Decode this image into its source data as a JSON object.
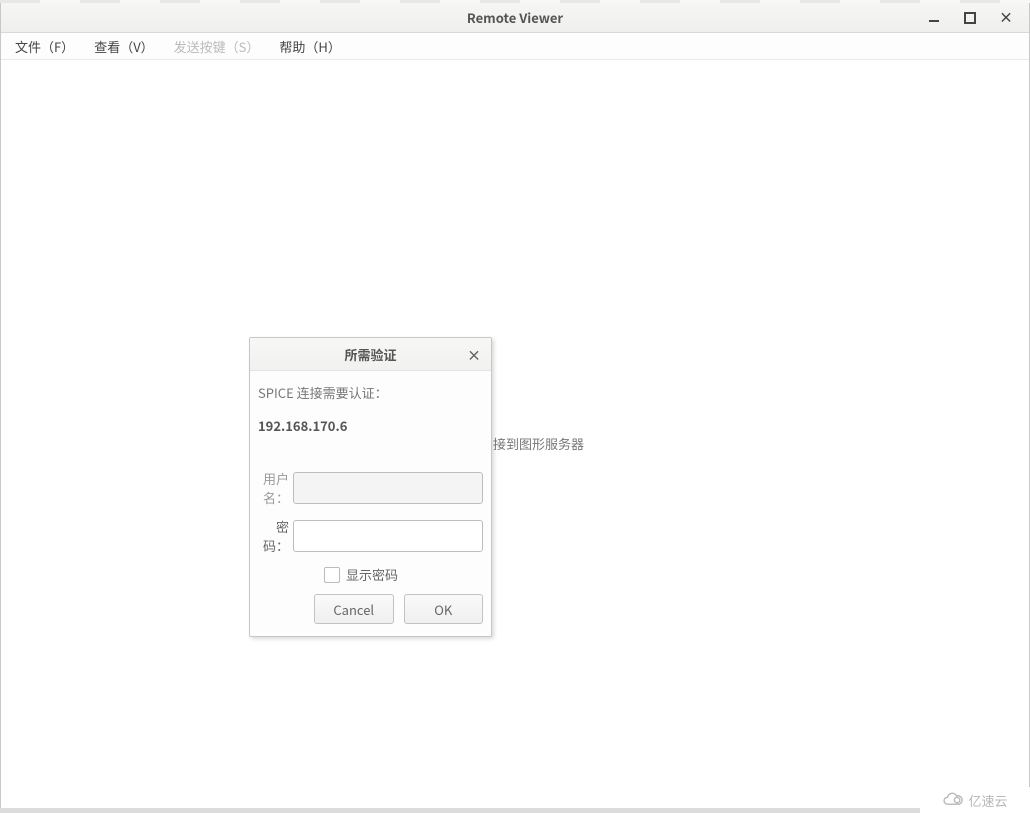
{
  "window": {
    "title": "Remote Viewer"
  },
  "menu": {
    "file": "文件（F）",
    "view": "查看（V）",
    "sendkeys": "发送按键（S）",
    "help": "帮助（H）"
  },
  "background": {
    "connecting_fragment": "接到图形服务器"
  },
  "dialog": {
    "title": "所需验证",
    "message": "SPICE 连接需要认证：",
    "host": "192.168.170.6",
    "username_label": "用户名：",
    "password_label": "密码：",
    "show_password_label": "显示密码",
    "cancel_label": "Cancel",
    "ok_label": "OK"
  },
  "watermark": {
    "text": "亿速云"
  }
}
